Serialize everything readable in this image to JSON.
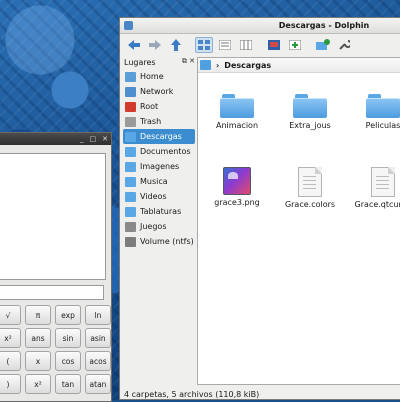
{
  "dolphin": {
    "title": "Descargas - Dolphin",
    "places_title": "Lugares",
    "places": [
      {
        "label": "Home",
        "icon": "home-icon",
        "color": "#5a9fd8"
      },
      {
        "label": "Network",
        "icon": "network-icon",
        "color": "#4f8fcf"
      },
      {
        "label": "Root",
        "icon": "root-folder-icon",
        "color": "#d23b2e"
      },
      {
        "label": "Trash",
        "icon": "trash-icon",
        "color": "#9a9a9a"
      },
      {
        "label": "Descargas",
        "icon": "downloads-folder-icon",
        "color": "#5aa7e6"
      },
      {
        "label": "Documentos",
        "icon": "documents-folder-icon",
        "color": "#5aa7e6"
      },
      {
        "label": "Imagenes",
        "icon": "images-folder-icon",
        "color": "#5aa7e6"
      },
      {
        "label": "Musica",
        "icon": "music-folder-icon",
        "color": "#5aa7e6"
      },
      {
        "label": "Videos",
        "icon": "videos-folder-icon",
        "color": "#5aa7e6"
      },
      {
        "label": "Tablaturas",
        "icon": "folder-icon",
        "color": "#5aa7e6"
      },
      {
        "label": "Juegos",
        "icon": "games-icon",
        "color": "#8a8a8a"
      },
      {
        "label": "Volume (ntfs)",
        "icon": "drive-icon",
        "color": "#7d7d7d"
      }
    ],
    "selected_place": "Descargas",
    "breadcrumb": "Descargas",
    "items": [
      {
        "label": "Animacion",
        "type": "folder"
      },
      {
        "label": "Extra_jous",
        "type": "folder"
      },
      {
        "label": "Peliculas",
        "type": "folder"
      },
      {
        "label": "grace3.png",
        "type": "image"
      },
      {
        "label": "Grace.colors",
        "type": "document"
      },
      {
        "label": "Grace.qtcurve",
        "type": "document"
      }
    ],
    "status": "4 carpetas, 5 archivos (110,8 kiB)",
    "accent_color": "#3c8dd0"
  },
  "calculator": {
    "buttons": [
      "√",
      "π",
      "exp",
      "ln",
      "x²",
      "ans",
      "sin",
      "asin",
      "(",
      "x",
      "cos",
      "acos",
      ")",
      "x²",
      "tan",
      "atan"
    ]
  }
}
